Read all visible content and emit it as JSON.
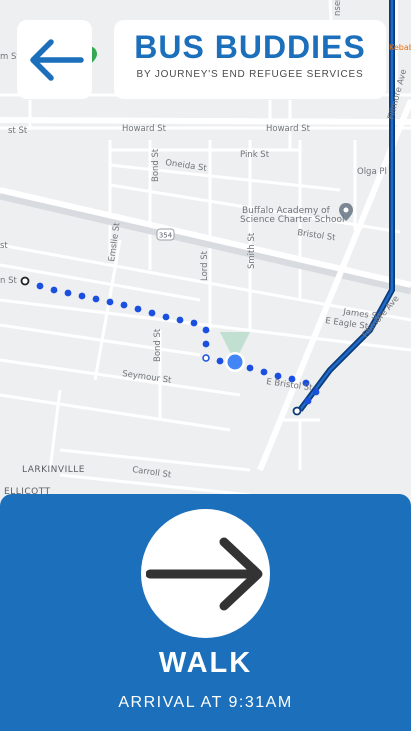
{
  "header": {
    "title": "BUS BUDDIES",
    "subtitle": "BY JOURNEY'S END REFUGEE SERVICES"
  },
  "back_button": {
    "icon": "arrow-left-icon"
  },
  "map": {
    "streets": {
      "howard_left": "Howard St",
      "howard_mid": "Howard St",
      "howard_right": "Howard St",
      "pink": "Pink St",
      "olga": "Olga Pl",
      "oneida": "Oneida St",
      "bond_upper": "Bond St",
      "bristol": "Bristol St",
      "emslie": "Emslie St",
      "lord": "Lord St",
      "smith": "Smith St",
      "james": "James St",
      "e_eagle": "E Eagle St",
      "bond_lower": "Bond St",
      "seymour": "Seymour St",
      "e_bristol": "E Bristol St",
      "carroll": "Carroll St",
      "fillmore_top": "Fillmore Ave",
      "fillmore_bottom": "Fillmore Ave",
      "route_354": "354",
      "left_edge_top": "m St",
      "left_edge_row2": "st St",
      "left_edge_row3": "st",
      "left_edge_row4": "n St"
    },
    "places": {
      "larkinville": "LARKINVILLE",
      "ellicott": "ELLICOTT"
    },
    "poi": {
      "school_line1": "Buffalo Academy of",
      "school_line2": "Science Charter School",
      "kebab": "Kebab",
      "top_cut": "nsend"
    },
    "colors": {
      "walk_route": "#1a4fe0",
      "bus_route": "#0d3b78",
      "user_dot": "#4285f4"
    }
  },
  "instruction": {
    "icon": "arrow-right-icon",
    "action": "WALK",
    "arrival": "ARRIVAL AT 9:31AM"
  },
  "colors": {
    "brand": "#1c6fbb"
  }
}
